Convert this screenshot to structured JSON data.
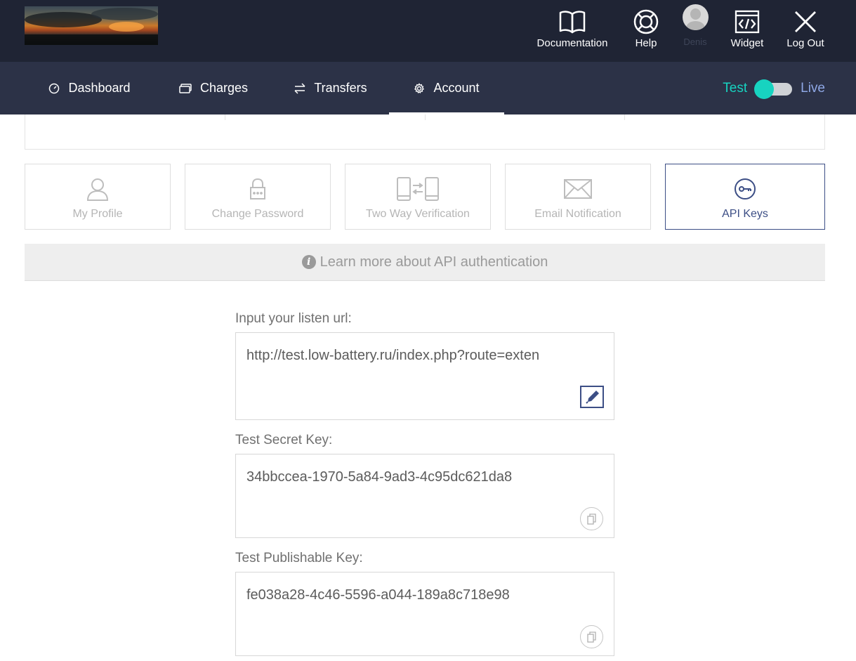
{
  "header": {
    "logo_alt": "",
    "nav": [
      {
        "label": "Documentation",
        "icon": "book-icon"
      },
      {
        "label": "Help",
        "icon": "lifebuoy-icon"
      },
      {
        "label": "Denis",
        "icon": "avatar"
      },
      {
        "label": "Widget",
        "icon": "code-window-icon"
      },
      {
        "label": "Log Out",
        "icon": "close-icon"
      }
    ]
  },
  "subnav": {
    "tabs": [
      {
        "label": "Dashboard",
        "icon": "gauge-icon"
      },
      {
        "label": "Charges",
        "icon": "card-icon"
      },
      {
        "label": "Transfers",
        "icon": "swap-arrows-icon"
      },
      {
        "label": "Account",
        "icon": "gear-icon",
        "active": true
      }
    ],
    "mode_toggle": {
      "left": "Test",
      "right": "Live",
      "selected": "Test"
    }
  },
  "account_tiles": [
    {
      "label": "My Profile",
      "icon": "user-icon"
    },
    {
      "label": "Change Password",
      "icon": "lock-icon"
    },
    {
      "label": "Two Way Verification",
      "icon": "phones-sync-icon"
    },
    {
      "label": "Email Notification",
      "icon": "envelope-icon"
    },
    {
      "label": "API Keys",
      "icon": "key-icon",
      "active": true
    }
  ],
  "info": {
    "text": "Learn more about API authentication",
    "icon": "info-icon"
  },
  "form": {
    "listen_url": {
      "label": "Input your listen url:",
      "value": "http://test.low-battery.ru/index.php?route=exten"
    },
    "secret_key": {
      "label": "Test Secret Key:",
      "value": "34bbccea-1970-5a84-9ad3-4c95dc621da8"
    },
    "publishable_key": {
      "label": "Test Publishable Key:",
      "value": "fe038a28-4c46-5596-a044-189a8c718e98"
    }
  },
  "colors": {
    "header_bg": "#1f2434",
    "subnav_bg": "#2c3247",
    "accent_teal": "#17d3c0",
    "accent_blue": "#3c4e85",
    "live_blue": "#8fa8e6"
  }
}
